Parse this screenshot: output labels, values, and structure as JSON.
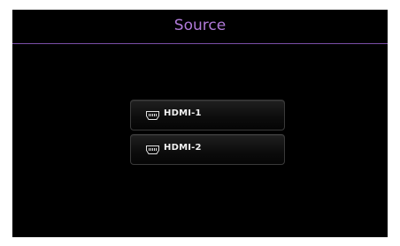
{
  "header": {
    "title": "Source",
    "title_color": "#b07ad8",
    "divider_color": "#7b4fa8"
  },
  "sources": [
    {
      "label": "HDMI-1",
      "icon": "hdmi-port-icon"
    },
    {
      "label": "HDMI-2",
      "icon": "hdmi-port-icon"
    }
  ]
}
